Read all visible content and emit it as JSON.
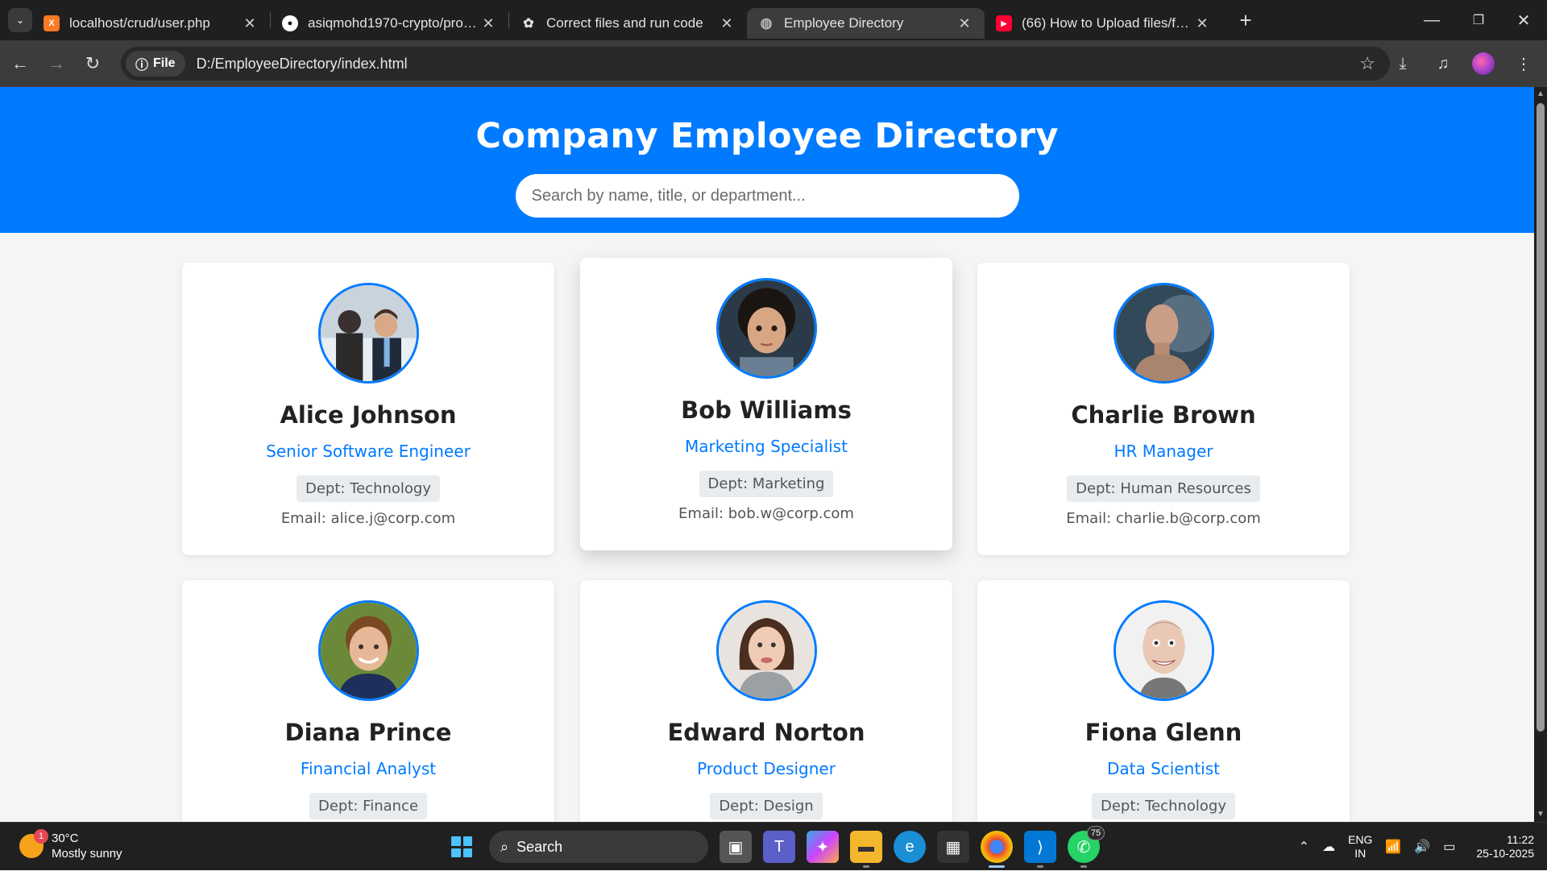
{
  "browser": {
    "tabs": [
      {
        "title": "localhost/crud/user.php",
        "favicon": "xampp-icon",
        "color": "#fb7a24"
      },
      {
        "title": "asiqmohd1970-crypto/project",
        "favicon": "github-icon",
        "color": "#ffffff"
      },
      {
        "title": "Correct files and run code",
        "favicon": "chatgpt-icon",
        "color": "#ffffff"
      },
      {
        "title": "Employee Directory",
        "favicon": "globe-icon",
        "color": "#bbbbbb",
        "active": true
      },
      {
        "title": "(66) How to Upload files/folders",
        "favicon": "youtube-icon",
        "color": "#ff0033"
      }
    ],
    "address_chip": "File",
    "url": "D:/EmployeeDirectory/index.html"
  },
  "page": {
    "heading": "Company Employee Directory",
    "search_placeholder": "Search by name, title, or department...",
    "accent": "#007bff",
    "employees": [
      {
        "name": "Alice Johnson",
        "title": "Senior Software Engineer",
        "dept": "Dept: Technology",
        "email": "Email: alice.j@corp.com"
      },
      {
        "name": "Bob Williams",
        "title": "Marketing Specialist",
        "dept": "Dept: Marketing",
        "email": "Email: bob.w@corp.com"
      },
      {
        "name": "Charlie Brown",
        "title": "HR Manager",
        "dept": "Dept: Human Resources",
        "email": "Email: charlie.b@corp.com"
      },
      {
        "name": "Diana Prince",
        "title": "Financial Analyst",
        "dept": "Dept: Finance"
      },
      {
        "name": "Edward Norton",
        "title": "Product Designer",
        "dept": "Dept: Design"
      },
      {
        "name": "Fiona Glenn",
        "title": "Data Scientist",
        "dept": "Dept: Technology"
      }
    ]
  },
  "taskbar": {
    "weather": {
      "temp": "30°C",
      "desc": "Mostly sunny",
      "badge": "1"
    },
    "search_label": "Search",
    "whatsapp_badge": "75",
    "lang_top": "ENG",
    "lang_bottom": "IN",
    "time": "11:22",
    "date": "25-10-2025"
  }
}
